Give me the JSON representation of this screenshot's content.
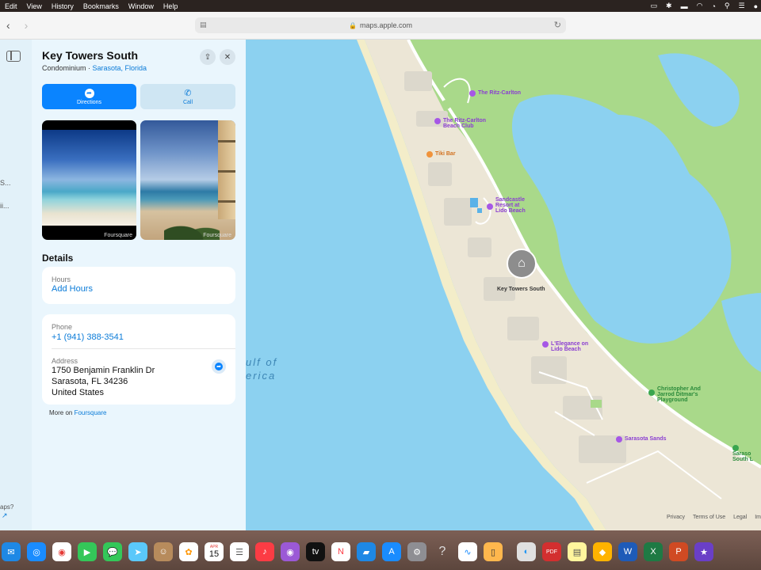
{
  "menubar": {
    "items": [
      "Edit",
      "View",
      "History",
      "Bookmarks",
      "Window",
      "Help"
    ]
  },
  "browser": {
    "url": "maps.apple.com"
  },
  "sidebar_strip": {
    "partial_texts": [
      "S...",
      "ii...",
      "aps?",
      "↗"
    ]
  },
  "place": {
    "title": "Key Towers South",
    "category": "Condominium",
    "separator": " · ",
    "location": "Sarasota, Florida",
    "directions_label": "Directions",
    "call_label": "Call",
    "photo_credit": "Foursquare",
    "details_heading": "Details",
    "hours_label": "Hours",
    "hours_value": "Add Hours",
    "phone_label": "Phone",
    "phone_value": "+1 (941) 388-3541",
    "address_label": "Address",
    "address_line1": "1750 Benjamin Franklin Dr",
    "address_line2": "Sarasota, FL 34236",
    "address_line3": "United States",
    "more_on": "More on ",
    "more_source": "Foursquare"
  },
  "map": {
    "pois": {
      "ritz": "The Ritz-Carlton",
      "ritz_beach_1": "The Ritz-Carlton",
      "ritz_beach_2": "Beach Club",
      "tiki": "Tiki Bar",
      "sandcastle_1": "Sandcastle",
      "sandcastle_2": "Resort at",
      "sandcastle_3": "Lido Beach",
      "elegance_1": "L'Elegance on",
      "elegance_2": "Lido Beach",
      "playground_1": "Christopher And",
      "playground_2": "Jarrod Ditmar's",
      "playground_3": "Playground",
      "sarasota_sands": "Sarasota Sands",
      "sarasota_south_1": "Saraso",
      "sarasota_south_2": "South L"
    },
    "pin_label": "Key Towers South",
    "gulf_1": "ulf of",
    "gulf_2": "erica",
    "footer": [
      "Privacy",
      "Terms of Use",
      "Legal",
      "Im"
    ]
  },
  "dock": {
    "apps": [
      "mail",
      "safari",
      "chrome",
      "facetime",
      "messages",
      "maps",
      "contacts",
      "photos",
      "calendar",
      "reminders",
      "music",
      "podcasts",
      "tv",
      "news",
      "keynote",
      "app-store",
      "settings",
      "help",
      "activity",
      "iphone-mirroring",
      "preview",
      "acrobat",
      "notes",
      "sketch",
      "word",
      "excel",
      "powerpoint",
      "imovie"
    ],
    "calendar_month": "APR",
    "calendar_day": "15"
  },
  "colors": {
    "accent": "#0a84ff",
    "water": "#8cd1f0",
    "land": "#a9d98a",
    "beach": "#ece6d6",
    "poi_purple": "#8a3ed1"
  }
}
